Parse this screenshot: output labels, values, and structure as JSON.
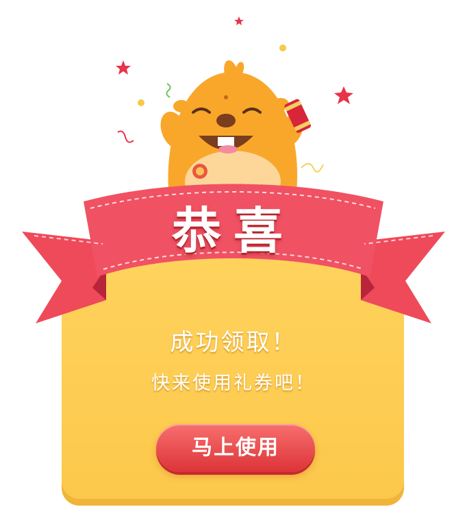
{
  "popup": {
    "title": "恭喜",
    "message_line1": "成功领取！",
    "message_line2": "快来使用礼券吧！",
    "button_label": "马上使用"
  },
  "colors": {
    "ribbon": "#ef4a5a",
    "ribbon_dark": "#c8313f",
    "card": "#fcc84a",
    "button": "#e84447",
    "mascot": "#f9a72b",
    "text": "#ffffff"
  },
  "icons": [
    "star-icon",
    "mascot-icon",
    "firecracker-icon",
    "medal-icon",
    "ribbon-banner"
  ]
}
